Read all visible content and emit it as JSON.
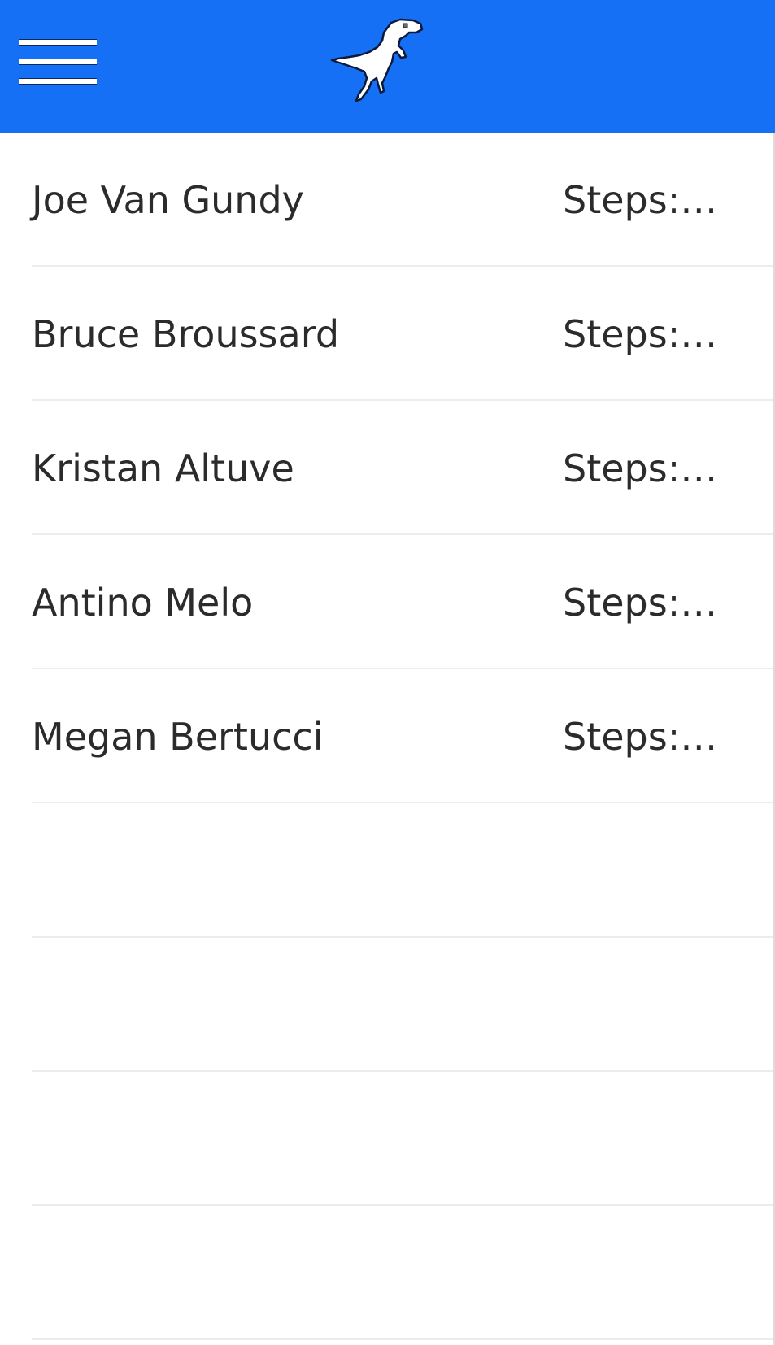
{
  "header": {
    "menu_icon": "hamburger-menu-icon",
    "logo_icon": "t-rex-dinosaur-icon",
    "background_color": "#1570f5"
  },
  "leaderboard": {
    "rows": [
      {
        "name": "Joe Van Gundy",
        "steps": "Steps:…"
      },
      {
        "name": "Bruce Broussard",
        "steps": "Steps:…"
      },
      {
        "name": "Kristan Altuve",
        "steps": "Steps:…"
      },
      {
        "name": "Antino Melo",
        "steps": "Steps:…"
      },
      {
        "name": "Megan Bertucci",
        "steps": "Steps:…"
      }
    ],
    "empty_rows": 4
  }
}
